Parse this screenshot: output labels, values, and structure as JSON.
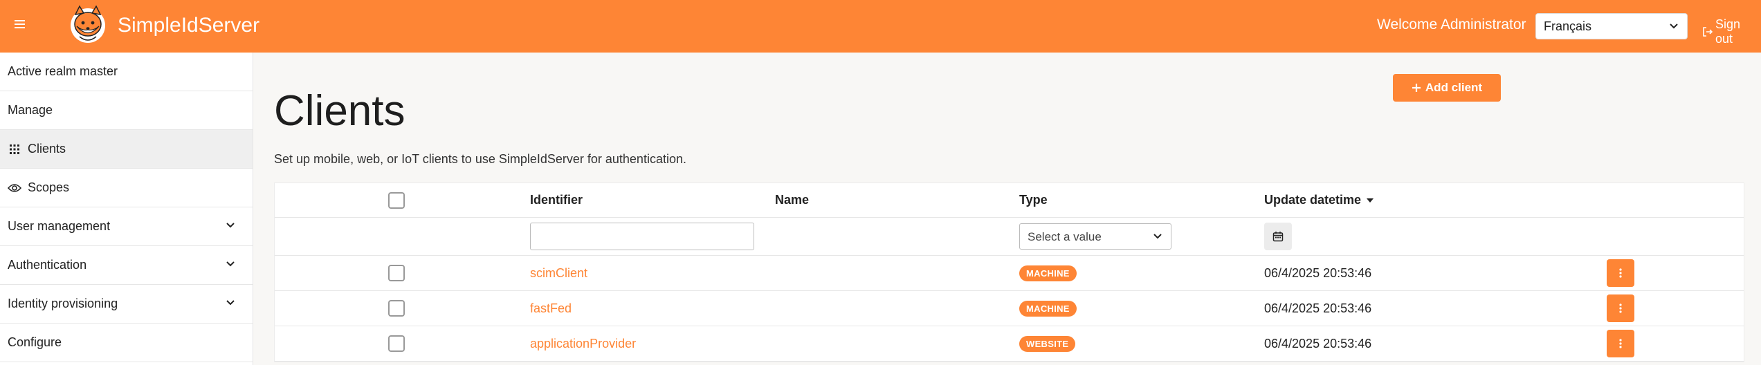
{
  "header": {
    "brand": "SimpleIdServer",
    "welcome": "Welcome Administrator",
    "language_selected": "Français",
    "sign_out": "Sign out",
    "accent_color": "#fe8535"
  },
  "sidebar": {
    "items": [
      {
        "label": "Active realm master"
      },
      {
        "label": "Manage"
      },
      {
        "label": "Clients",
        "icon": "grid-icon"
      },
      {
        "label": "Scopes",
        "icon": "eye-icon"
      },
      {
        "label": "User management"
      },
      {
        "label": "Authentication"
      },
      {
        "label": "Identity provisioning"
      },
      {
        "label": "Configure"
      }
    ]
  },
  "main": {
    "title": "Clients",
    "description": "Set up mobile, web, or IoT clients to use SimpleIdServer for authentication.",
    "add_button": "Add client",
    "columns": {
      "identifier": "Identifier",
      "name": "Name",
      "type": "Type",
      "update_datetime": "Update datetime"
    },
    "type_filter_placeholder": "Select a value",
    "rows": [
      {
        "identifier": "scimClient",
        "name": "",
        "type": "MACHINE",
        "updated": "06/4/2025 20:53:46"
      },
      {
        "identifier": "fastFed",
        "name": "",
        "type": "MACHINE",
        "updated": "06/4/2025 20:53:46"
      },
      {
        "identifier": "applicationProvider",
        "name": "",
        "type": "WEBSITE",
        "updated": "06/4/2025 20:53:46"
      }
    ]
  }
}
